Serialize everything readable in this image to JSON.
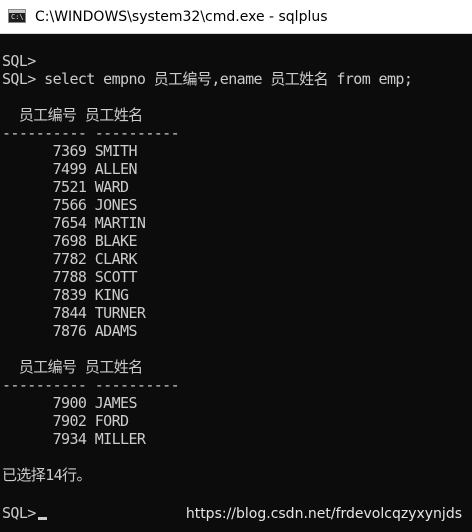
{
  "window": {
    "title": "C:\\WINDOWS\\system32\\cmd.exe - sqlplus",
    "icon": "console-window-icon",
    "icon_glyph": "C:\\"
  },
  "console": {
    "lines": [
      "SQL>",
      "SQL> select empno 员工编号,ename 员工姓名 from emp;",
      "",
      "  员工编号 员工姓名",
      "---------- ----------",
      "      7369 SMITH",
      "      7499 ALLEN",
      "      7521 WARD",
      "      7566 JONES",
      "      7654 MARTIN",
      "      7698 BLAKE",
      "      7782 CLARK",
      "      7788 SCOTT",
      "      7839 KING",
      "      7844 TURNER",
      "      7876 ADAMS",
      "",
      "  员工编号 员工姓名",
      "---------- ----------",
      "      7900 JAMES",
      "      7902 FORD",
      "      7934 MILLER",
      "",
      "已选择14行。"
    ],
    "prompt": "SQL>"
  },
  "watermark": "https://blog.csdn.net/frdevolcqzyxynjds",
  "colors": {
    "console_bg": "#0c0c0c",
    "console_fg": "#cccccc",
    "titlebar_bg": "#ffffff"
  }
}
